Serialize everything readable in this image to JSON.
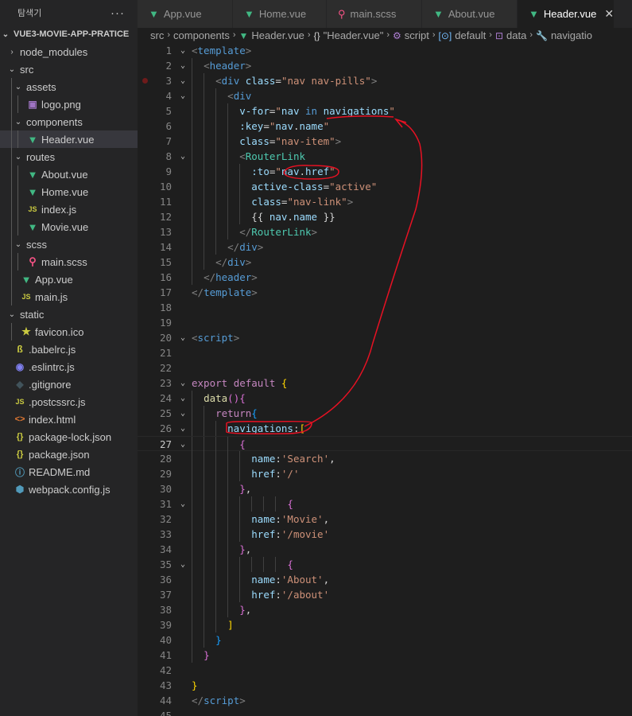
{
  "sidebar": {
    "title": "탐색기",
    "more": "···",
    "project": "VUE3-MOVIE-APP-PRATICE",
    "items": [
      {
        "label": "node_modules",
        "type": "folder",
        "expanded": false,
        "depth": 1
      },
      {
        "label": "src",
        "type": "folder",
        "expanded": true,
        "depth": 1
      },
      {
        "label": "assets",
        "type": "folder",
        "expanded": true,
        "depth": 2
      },
      {
        "label": "logo.png",
        "type": "image",
        "depth": 3
      },
      {
        "label": "components",
        "type": "folder",
        "expanded": true,
        "depth": 2
      },
      {
        "label": "Header.vue",
        "type": "vue",
        "depth": 3,
        "selected": true
      },
      {
        "label": "routes",
        "type": "folder",
        "expanded": true,
        "depth": 2
      },
      {
        "label": "About.vue",
        "type": "vue",
        "depth": 3
      },
      {
        "label": "Home.vue",
        "type": "vue",
        "depth": 3
      },
      {
        "label": "index.js",
        "type": "js",
        "depth": 3
      },
      {
        "label": "Movie.vue",
        "type": "vue",
        "depth": 3
      },
      {
        "label": "scss",
        "type": "folder",
        "expanded": true,
        "depth": 2
      },
      {
        "label": "main.scss",
        "type": "scss",
        "depth": 3
      },
      {
        "label": "App.vue",
        "type": "vue",
        "depth": 2
      },
      {
        "label": "main.js",
        "type": "js",
        "depth": 2
      },
      {
        "label": "static",
        "type": "folder",
        "expanded": true,
        "depth": 1
      },
      {
        "label": "favicon.ico",
        "type": "star",
        "depth": 2
      },
      {
        "label": ".babelrc.js",
        "type": "babel",
        "depth": 1
      },
      {
        "label": ".eslintrc.js",
        "type": "eslint",
        "depth": 1
      },
      {
        "label": ".gitignore",
        "type": "git",
        "depth": 1
      },
      {
        "label": ".postcssrc.js",
        "type": "js",
        "depth": 1
      },
      {
        "label": "index.html",
        "type": "html",
        "depth": 1
      },
      {
        "label": "package-lock.json",
        "type": "json",
        "depth": 1
      },
      {
        "label": "package.json",
        "type": "json",
        "depth": 1
      },
      {
        "label": "README.md",
        "type": "info",
        "depth": 1
      },
      {
        "label": "webpack.config.js",
        "type": "webpack",
        "depth": 1
      }
    ]
  },
  "icons": {
    "vue": "▼",
    "js": "JS",
    "scss": "⚲",
    "image": "▣",
    "star": "★",
    "babel": "ß",
    "eslint": "◉",
    "git": "◆",
    "html": "<>",
    "json": "{}",
    "info": "ⓘ",
    "webpack": "⬢"
  },
  "tabs": [
    {
      "label": "App.vue",
      "type": "vue"
    },
    {
      "label": "Home.vue",
      "type": "vue"
    },
    {
      "label": "main.scss",
      "type": "scss"
    },
    {
      "label": "About.vue",
      "type": "vue"
    },
    {
      "label": "Header.vue",
      "type": "vue",
      "active": true
    }
  ],
  "tab_close": "✕",
  "breadcrumb": [
    {
      "label": "src"
    },
    {
      "label": "components"
    },
    {
      "label": "Header.vue",
      "icon": "vue"
    },
    {
      "label": "\"Header.vue\"",
      "icon": "{}"
    },
    {
      "label": "script",
      "icon": "script"
    },
    {
      "label": "default",
      "icon": "default"
    },
    {
      "label": "data",
      "icon": "data"
    },
    {
      "label": "navigatio",
      "icon": "wrench"
    }
  ],
  "editor": {
    "current_line": 27,
    "breakpoint_line": 3,
    "lines": [
      {
        "n": 1,
        "fold": "⌄",
        "tokens": [
          [
            "t-br",
            "<"
          ],
          [
            "t-tag",
            "template"
          ],
          [
            "t-br",
            ">"
          ]
        ]
      },
      {
        "n": 2,
        "fold": "⌄",
        "tokens": [
          [
            "t-pl",
            "  "
          ],
          [
            "t-br",
            "<"
          ],
          [
            "t-tag",
            "header"
          ],
          [
            "t-br",
            ">"
          ]
        ]
      },
      {
        "n": 3,
        "fold": "⌄",
        "tokens": [
          [
            "t-pl",
            "    "
          ],
          [
            "t-br",
            "<"
          ],
          [
            "t-tag",
            "div"
          ],
          [
            "t-pl",
            " "
          ],
          [
            "t-at",
            "class"
          ],
          [
            "t-pl",
            "="
          ],
          [
            "t-st",
            "\"nav nav-pills\""
          ],
          [
            "t-br",
            ">"
          ]
        ]
      },
      {
        "n": 4,
        "fold": "⌄",
        "tokens": [
          [
            "t-pl",
            "      "
          ],
          [
            "t-br",
            "<"
          ],
          [
            "t-tag",
            "div"
          ]
        ]
      },
      {
        "n": 5,
        "tokens": [
          [
            "t-pl",
            "        "
          ],
          [
            "t-at",
            "v-for"
          ],
          [
            "t-pl",
            "="
          ],
          [
            "t-st",
            "\""
          ],
          [
            "t-at",
            "nav"
          ],
          [
            "t-pl",
            " "
          ],
          [
            "t-kb",
            "in"
          ],
          [
            "t-pl",
            " "
          ],
          [
            "t-at",
            "navigations"
          ],
          [
            "t-st",
            "\""
          ]
        ]
      },
      {
        "n": 6,
        "tokens": [
          [
            "t-pl",
            "        "
          ],
          [
            "t-at",
            ":key"
          ],
          [
            "t-pl",
            "="
          ],
          [
            "t-st",
            "\""
          ],
          [
            "t-at",
            "nav"
          ],
          [
            "t-pl",
            "."
          ],
          [
            "t-at",
            "name"
          ],
          [
            "t-st",
            "\""
          ]
        ]
      },
      {
        "n": 7,
        "tokens": [
          [
            "t-pl",
            "        "
          ],
          [
            "t-at",
            "class"
          ],
          [
            "t-pl",
            "="
          ],
          [
            "t-st",
            "\"nav-item\""
          ],
          [
            "t-br",
            ">"
          ]
        ]
      },
      {
        "n": 8,
        "fold": "⌄",
        "tokens": [
          [
            "t-pl",
            "        "
          ],
          [
            "t-br",
            "<"
          ],
          [
            "t-cn",
            "RouterLink"
          ]
        ]
      },
      {
        "n": 9,
        "tokens": [
          [
            "t-pl",
            "          "
          ],
          [
            "t-at",
            ":to"
          ],
          [
            "t-pl",
            "="
          ],
          [
            "t-st",
            "\""
          ],
          [
            "t-at",
            "nav"
          ],
          [
            "t-pl",
            "."
          ],
          [
            "t-at",
            "href"
          ],
          [
            "t-st",
            "\""
          ]
        ]
      },
      {
        "n": 10,
        "tokens": [
          [
            "t-pl",
            "          "
          ],
          [
            "t-at",
            "active-class"
          ],
          [
            "t-pl",
            "="
          ],
          [
            "t-st",
            "\"active\""
          ]
        ]
      },
      {
        "n": 11,
        "tokens": [
          [
            "t-pl",
            "          "
          ],
          [
            "t-at",
            "class"
          ],
          [
            "t-pl",
            "="
          ],
          [
            "t-st",
            "\"nav-link\""
          ],
          [
            "t-br",
            ">"
          ]
        ]
      },
      {
        "n": 12,
        "tokens": [
          [
            "t-pl",
            "          {{ "
          ],
          [
            "t-at",
            "nav"
          ],
          [
            "t-pl",
            "."
          ],
          [
            "t-at",
            "name"
          ],
          [
            "t-pl",
            " }}"
          ]
        ]
      },
      {
        "n": 13,
        "tokens": [
          [
            "t-pl",
            "        "
          ],
          [
            "t-br",
            "</"
          ],
          [
            "t-cn",
            "RouterLink"
          ],
          [
            "t-br",
            ">"
          ]
        ]
      },
      {
        "n": 14,
        "tokens": [
          [
            "t-pl",
            "      "
          ],
          [
            "t-br",
            "</"
          ],
          [
            "t-tag",
            "div"
          ],
          [
            "t-br",
            ">"
          ]
        ]
      },
      {
        "n": 15,
        "tokens": [
          [
            "t-pl",
            "    "
          ],
          [
            "t-br",
            "</"
          ],
          [
            "t-tag",
            "div"
          ],
          [
            "t-br",
            ">"
          ]
        ]
      },
      {
        "n": 16,
        "tokens": [
          [
            "t-pl",
            "  "
          ],
          [
            "t-br",
            "</"
          ],
          [
            "t-tag",
            "header"
          ],
          [
            "t-br",
            ">"
          ]
        ]
      },
      {
        "n": 17,
        "tokens": [
          [
            "t-br",
            "</"
          ],
          [
            "t-tag",
            "template"
          ],
          [
            "t-br",
            ">"
          ]
        ]
      },
      {
        "n": 18,
        "tokens": []
      },
      {
        "n": 19,
        "tokens": []
      },
      {
        "n": 20,
        "fold": "⌄",
        "tokens": [
          [
            "t-br",
            "<"
          ],
          [
            "t-tag",
            "script"
          ],
          [
            "t-br",
            ">"
          ]
        ]
      },
      {
        "n": 21,
        "tokens": []
      },
      {
        "n": 22,
        "tokens": []
      },
      {
        "n": 23,
        "fold": "⌄",
        "tokens": [
          [
            "t-kw",
            "export"
          ],
          [
            "t-pl",
            " "
          ],
          [
            "t-kw",
            "default"
          ],
          [
            "t-pl",
            " "
          ],
          [
            "t-br1",
            "{"
          ]
        ]
      },
      {
        "n": 24,
        "fold": "⌄",
        "tokens": [
          [
            "t-pl",
            "  "
          ],
          [
            "t-fn",
            "data"
          ],
          [
            "t-br2",
            "()"
          ],
          [
            "t-br2",
            "{"
          ]
        ]
      },
      {
        "n": 25,
        "fold": "⌄",
        "tokens": [
          [
            "t-pl",
            "    "
          ],
          [
            "t-kw",
            "return"
          ],
          [
            "t-br3",
            "{"
          ]
        ]
      },
      {
        "n": 26,
        "fold": "⌄",
        "tokens": [
          [
            "t-pl",
            "      "
          ],
          [
            "t-at",
            "navigations"
          ],
          [
            "t-pl",
            ":"
          ],
          [
            "t-br1",
            "["
          ]
        ]
      },
      {
        "n": 27,
        "fold": "⌄",
        "tokens": [
          [
            "t-pl",
            "        "
          ],
          [
            "t-br2",
            "{"
          ]
        ]
      },
      {
        "n": 28,
        "tokens": [
          [
            "t-pl",
            "          "
          ],
          [
            "t-at",
            "name"
          ],
          [
            "t-pl",
            ":"
          ],
          [
            "t-st",
            "'Search'"
          ],
          [
            "t-pl",
            ","
          ]
        ]
      },
      {
        "n": 29,
        "tokens": [
          [
            "t-pl",
            "          "
          ],
          [
            "t-at",
            "href"
          ],
          [
            "t-pl",
            ":"
          ],
          [
            "t-st",
            "'/'"
          ]
        ]
      },
      {
        "n": 30,
        "tokens": [
          [
            "t-pl",
            "        "
          ],
          [
            "t-br2",
            "}"
          ],
          [
            "t-pl",
            ","
          ]
        ]
      },
      {
        "n": 31,
        "fold": "⌄",
        "tokens": [
          [
            "t-pl",
            "                "
          ],
          [
            "t-br2",
            "{"
          ]
        ]
      },
      {
        "n": 32,
        "tokens": [
          [
            "t-pl",
            "          "
          ],
          [
            "t-at",
            "name"
          ],
          [
            "t-pl",
            ":"
          ],
          [
            "t-st",
            "'Movie'"
          ],
          [
            "t-pl",
            ","
          ]
        ]
      },
      {
        "n": 33,
        "tokens": [
          [
            "t-pl",
            "          "
          ],
          [
            "t-at",
            "href"
          ],
          [
            "t-pl",
            ":"
          ],
          [
            "t-st",
            "'/movie'"
          ]
        ]
      },
      {
        "n": 34,
        "tokens": [
          [
            "t-pl",
            "        "
          ],
          [
            "t-br2",
            "}"
          ],
          [
            "t-pl",
            ","
          ]
        ]
      },
      {
        "n": 35,
        "fold": "⌄",
        "tokens": [
          [
            "t-pl",
            "                "
          ],
          [
            "t-br2",
            "{"
          ]
        ]
      },
      {
        "n": 36,
        "tokens": [
          [
            "t-pl",
            "          "
          ],
          [
            "t-at",
            "name"
          ],
          [
            "t-pl",
            ":"
          ],
          [
            "t-st",
            "'About'"
          ],
          [
            "t-pl",
            ","
          ]
        ]
      },
      {
        "n": 37,
        "tokens": [
          [
            "t-pl",
            "          "
          ],
          [
            "t-at",
            "href"
          ],
          [
            "t-pl",
            ":"
          ],
          [
            "t-st",
            "'/about'"
          ]
        ]
      },
      {
        "n": 38,
        "tokens": [
          [
            "t-pl",
            "        "
          ],
          [
            "t-br2",
            "}"
          ],
          [
            "t-pl",
            ","
          ]
        ]
      },
      {
        "n": 39,
        "tokens": [
          [
            "t-pl",
            "      "
          ],
          [
            "t-br1",
            "]"
          ]
        ]
      },
      {
        "n": 40,
        "tokens": [
          [
            "t-pl",
            "    "
          ],
          [
            "t-br3",
            "}"
          ]
        ]
      },
      {
        "n": 41,
        "tokens": [
          [
            "t-pl",
            "  "
          ],
          [
            "t-br2",
            "}"
          ]
        ]
      },
      {
        "n": 42,
        "tokens": []
      },
      {
        "n": 43,
        "tokens": [
          [
            "t-br1",
            "}"
          ]
        ]
      },
      {
        "n": 44,
        "tokens": [
          [
            "t-br",
            "</"
          ],
          [
            "t-tag",
            "script"
          ],
          [
            "t-br",
            ">"
          ]
        ]
      },
      {
        "n": 45,
        "tokens": []
      }
    ]
  },
  "annotation_color": "#e81123"
}
